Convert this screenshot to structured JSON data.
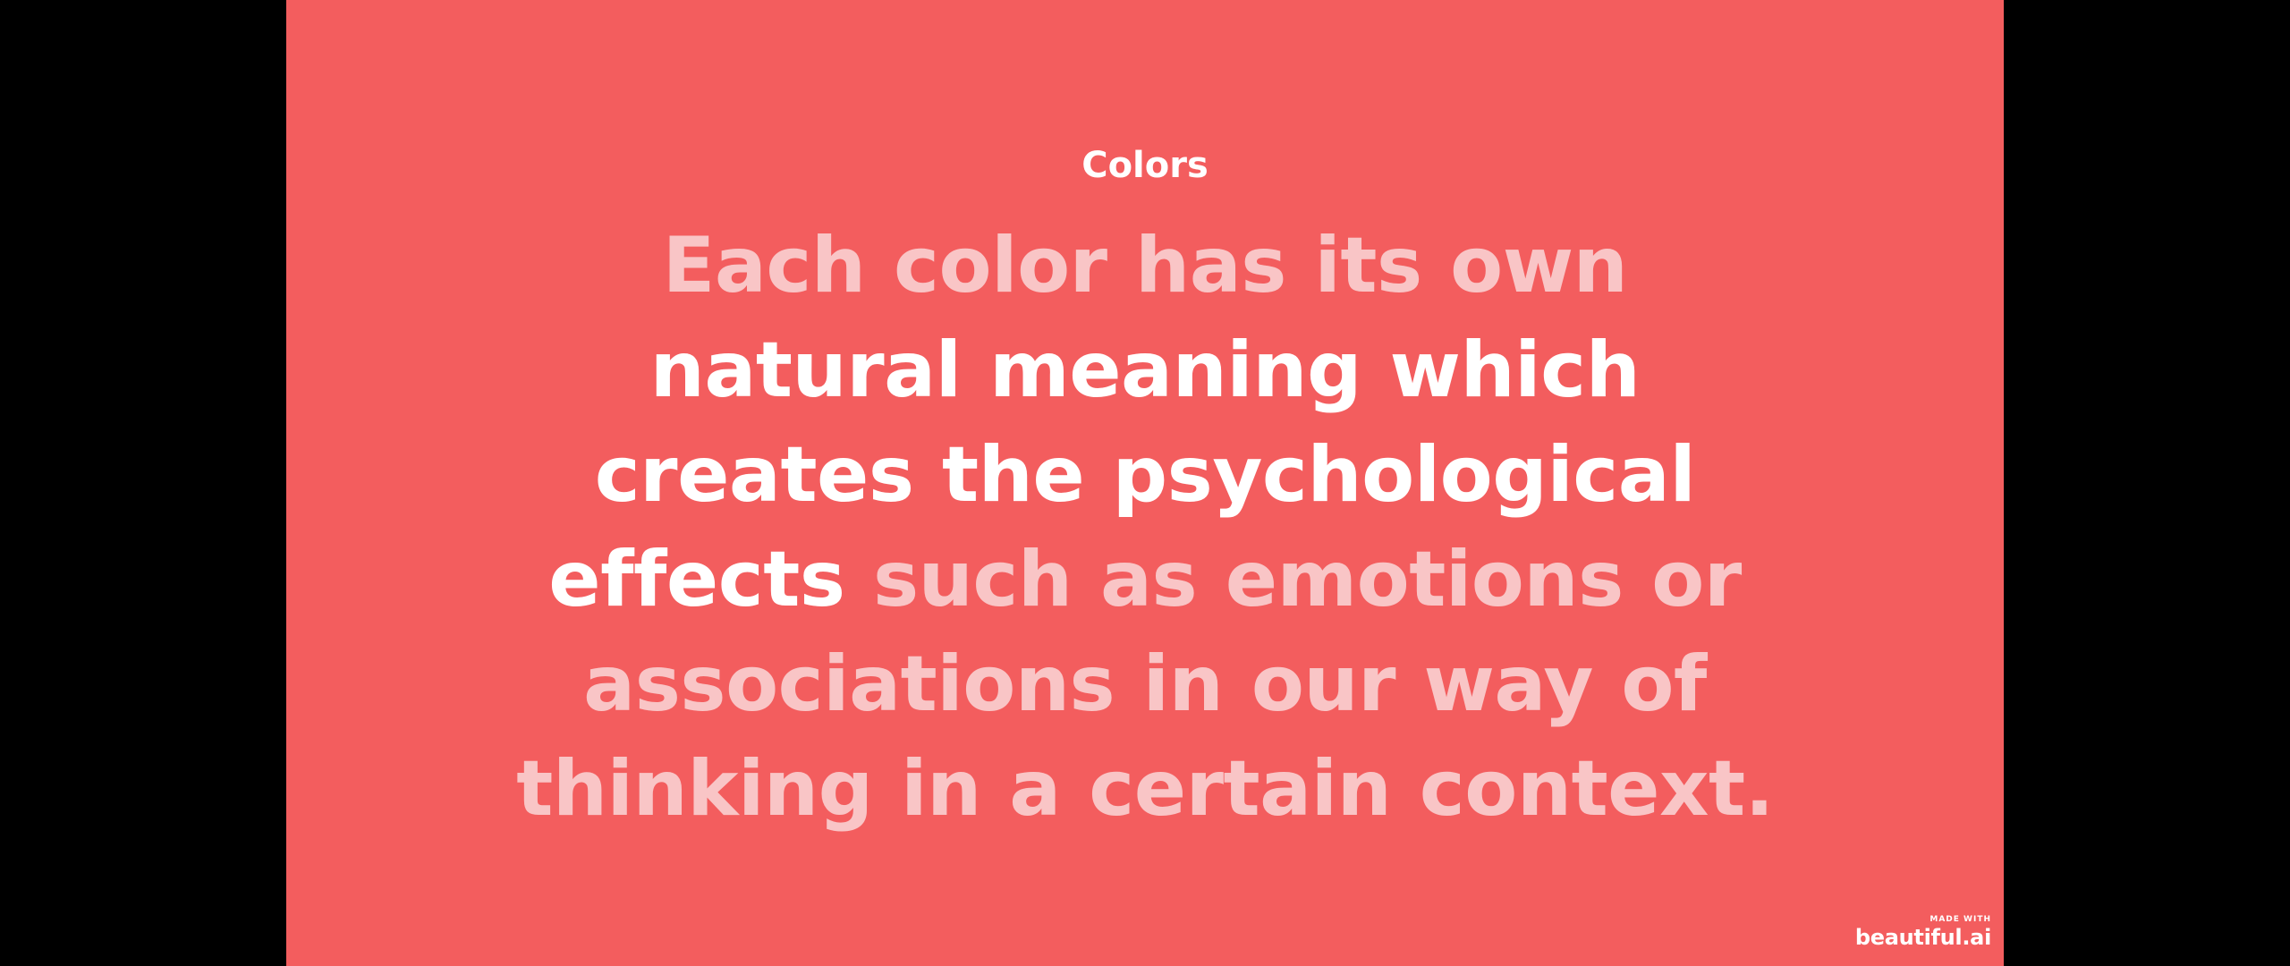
{
  "slide": {
    "background_color": "#f35d5e",
    "title": "Colors",
    "quote_lines": [
      [
        {
          "text": "Each color has its own",
          "emphasis": false
        }
      ],
      [
        {
          "text": "natural meaning which",
          "emphasis": true
        }
      ],
      [
        {
          "text": "creates the psychological",
          "emphasis": true
        }
      ],
      [
        {
          "text": "effects",
          "emphasis": true
        },
        {
          "text": " such as emotions or",
          "emphasis": false
        }
      ],
      [
        {
          "text": "associations in our way of",
          "emphasis": false
        }
      ],
      [
        {
          "text": "thinking in a certain context.",
          "emphasis": false
        }
      ]
    ],
    "colors": {
      "emphasis_text": "#ffffff",
      "muted_text": "#f9c5c6"
    }
  },
  "badge": {
    "small_text": "MADE WITH",
    "logo_text": "beautiful.ai"
  }
}
